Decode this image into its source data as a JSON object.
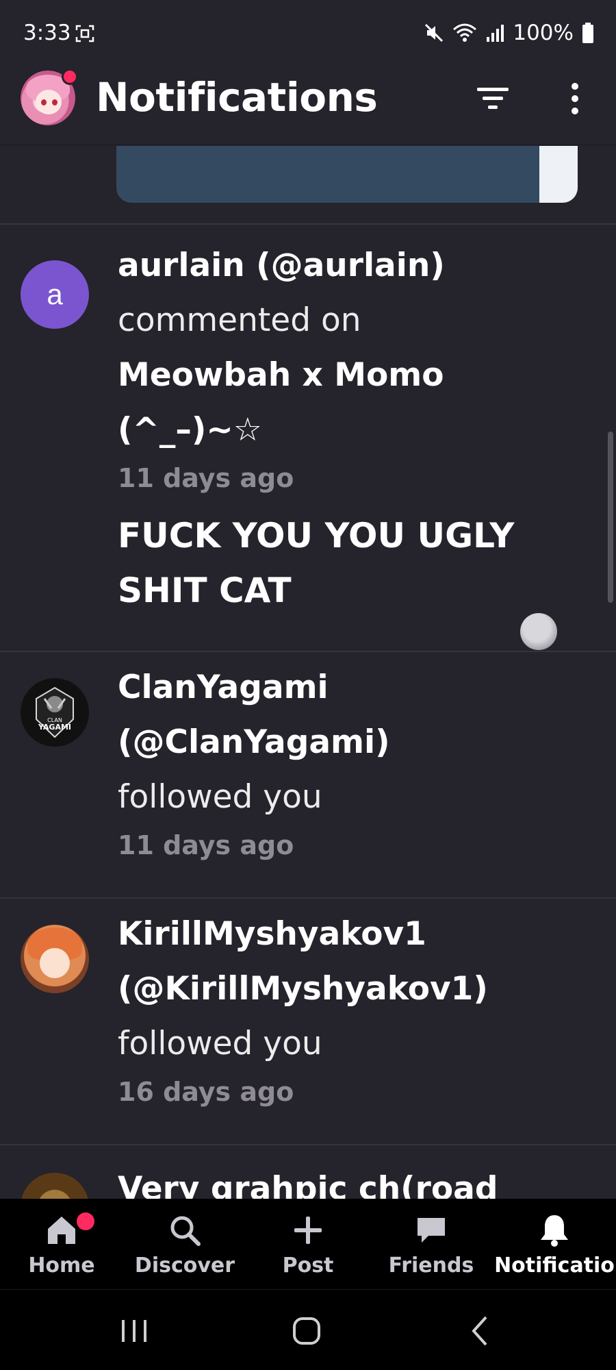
{
  "status_bar": {
    "time": "3:33",
    "battery": "100%",
    "icons": [
      "screen-record-icon",
      "mute-icon",
      "wifi-icon",
      "signal-icon",
      "battery-icon"
    ]
  },
  "header": {
    "title": "Notifications",
    "icons": [
      "filter-icon",
      "more-vert-icon"
    ]
  },
  "notifications": [
    {
      "avatar_letter": "a",
      "user": "aurlain (@aurlain)",
      "action": "commented on",
      "target_line1": "Meowbah x Momo",
      "target_line2": "(^_–)~☆",
      "time": "11 days ago",
      "comment_line1": "FUCK YOU YOU UGLY",
      "comment_line2": "SHIT CAT"
    },
    {
      "user_line1": "ClanYagami",
      "user_line2": "(@ClanYagami)",
      "emblem_text_1": "CLAN",
      "emblem_text_2": "YAGAMI",
      "action": "followed you",
      "time": "11 days ago"
    },
    {
      "user_line1": "KirillMyshyakov1",
      "user_line2": "(@KirillMyshyakov1)",
      "action": "followed you",
      "time": "16 days ago"
    },
    {
      "title_partial": "Very grahpic ch(road"
    }
  ],
  "bottom_nav": [
    {
      "label": "Home",
      "icon": "home-icon"
    },
    {
      "label": "Discover",
      "icon": "search-icon"
    },
    {
      "label": "Post",
      "icon": "plus-icon"
    },
    {
      "label": "Friends",
      "icon": "chat-bubble-icon"
    },
    {
      "label": "Notificatio",
      "icon": "bell-icon"
    }
  ],
  "colors": {
    "background": "#25232b",
    "accent_dot": "#ff2a5f",
    "avatar_letter_bg": "#7b55cf",
    "muted_text": "#8e8b96"
  }
}
